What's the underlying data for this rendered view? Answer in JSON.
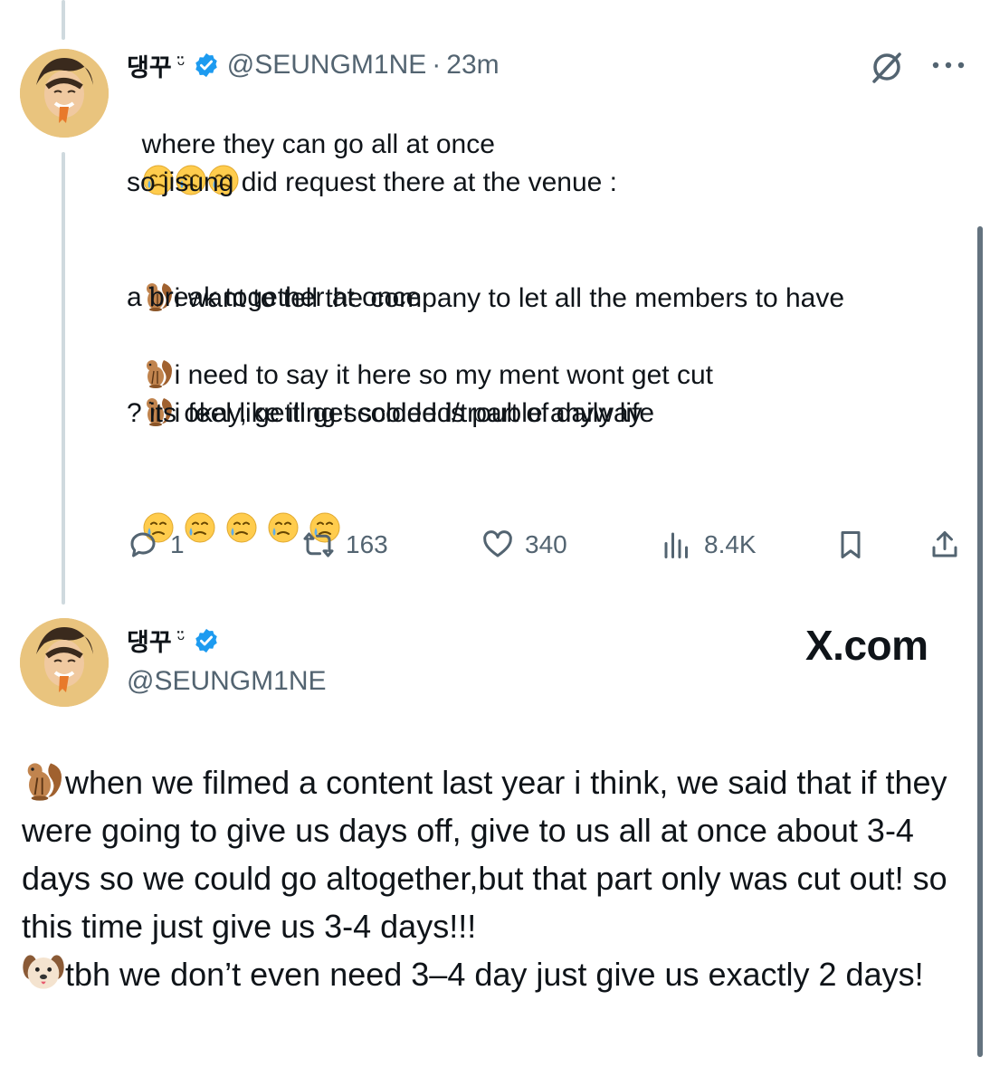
{
  "tweet": {
    "display_name": "댕꾸",
    "name_suffix": "ᵕ̈",
    "handle": "@SEUNGM1NE",
    "separator": "·",
    "time": "23m",
    "line1": "where they can go all at once",
    "line2": "so jisung did request there at the venue :",
    "line3a": "i want to tell the company to let all the members to have",
    "line3b": "a break together at once",
    "line4": "i need to say it here so my ment wont get cut",
    "line5": "i feel like ill get scolded/trouble anyway",
    "line6": "? its okay, getting scolded is part of daily life",
    "emoji_cry_count_line1": 3,
    "emoji_cry_count_end": 5
  },
  "actions": {
    "replies": "1",
    "retweets": "163",
    "likes": "340",
    "views": "8.4K"
  },
  "quoted": {
    "display_name": "댕꾸",
    "name_suffix": "ᵕ̈",
    "handle": "@SEUNGM1NE",
    "watermark": "X.com",
    "para1": "when we filmed a content last year i think, we said that if they were going to give us days off, give to us all at once about 3-4 days so we could go altogether,but that part only was cut out! so this time just give us 3-4 days!!!",
    "para2": "tbh we don’t even need 3–4 day just give us exactly 2 days!"
  },
  "icons": {
    "verified": "verified-badge-icon",
    "grok": "grok-icon",
    "more": "more-options-icon",
    "reply": "reply-icon",
    "retweet": "retweet-icon",
    "like": "heart-icon",
    "views": "views-icon",
    "bookmark": "bookmark-icon",
    "share": "share-icon",
    "chipmunk": "chipmunk-emoji",
    "dog": "dog-face-emoji",
    "cry": "face-holding-back-tears-emoji"
  },
  "colors": {
    "verified_blue": "#1d9bf0",
    "secondary_text": "#536471",
    "thread_line": "#cfd9de"
  }
}
